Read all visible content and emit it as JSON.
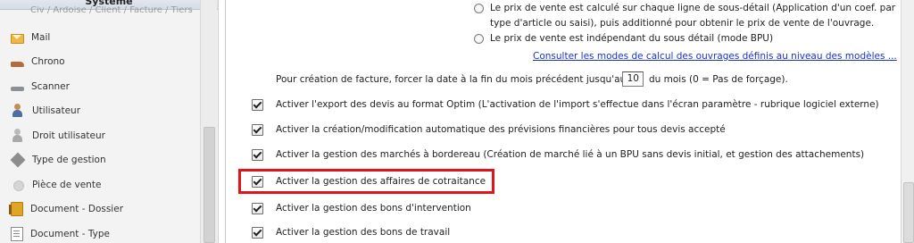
{
  "sidebar": {
    "header_title": "Système",
    "partial_text": "Civ / Ardoise / Client / Facture / Tiers",
    "items": [
      {
        "label": "Mail",
        "icon": "mail-icon"
      },
      {
        "label": "Chrono",
        "icon": "chrono-icon"
      },
      {
        "label": "Scanner",
        "icon": "scanner-icon"
      },
      {
        "label": "Utilisateur",
        "icon": "user-icon"
      },
      {
        "label": "Droit utilisateur",
        "icon": "user-rights-icon"
      },
      {
        "label": "Type de gestion",
        "icon": "management-type-icon"
      },
      {
        "label": "Pièce de vente",
        "icon": "sales-document-icon"
      },
      {
        "label": "Document - Dossier",
        "icon": "folder-document-icon"
      },
      {
        "label": "Document - Type",
        "icon": "document-type-icon"
      }
    ]
  },
  "options": {
    "radio_calc_line1": "Le prix de vente est calculé sur chaque ligne de sous-détail (Application d'un coef. par",
    "radio_calc_line2": "type d'article ou saisi), puis additionné pour obtenir le prix de vente de l'ouvrage.",
    "radio_indep": "Le prix de vente est indépendant du sous détail (mode BPU)",
    "link_modes": "Consulter les modes de calcul des ouvrages définis au niveau des modèles ...",
    "facture_prefix": "Pour création de facture, forcer la date à la fin du mois précédent jusqu'au",
    "facture_value": "10",
    "facture_suffix": "du mois (0 = Pas de forçage).",
    "checkboxes": [
      {
        "label": "Activer l'export des devis au format Optim (L'activation de l'import s'effectue dans l'écran paramètre - rubrique logiciel externe)",
        "checked": true
      },
      {
        "label": "Activer la création/modification automatique des prévisions financières pour tous devis accepté",
        "checked": true
      },
      {
        "label": "Activer la gestion des marchés à bordereau (Création de marché lié à un BPU sans devis initial, et gestion des attachements)",
        "checked": true
      },
      {
        "label": "Activer la gestion des affaires de cotraitance",
        "checked": true,
        "highlighted": true
      },
      {
        "label": "Activer la gestion des bons d'intervention",
        "checked": true
      },
      {
        "label": "Activer la gestion des bons de travail",
        "checked": true
      }
    ]
  },
  "colors": {
    "highlight": "#e0151c",
    "link": "#1a33c7"
  }
}
